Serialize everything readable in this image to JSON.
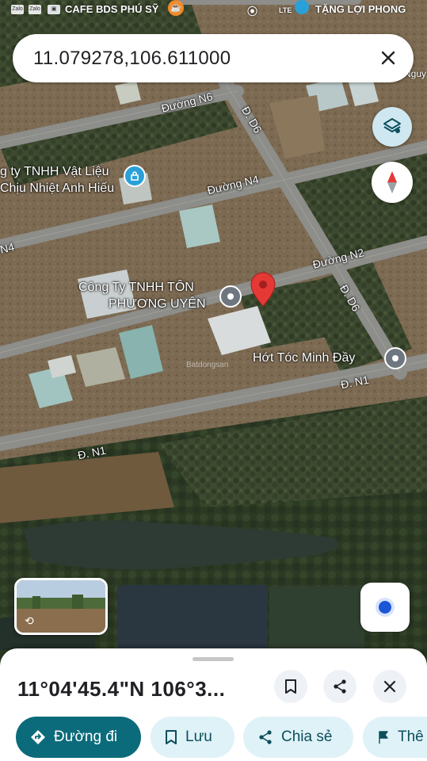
{
  "status_bar": {
    "apps": [
      "Zalo",
      "Zalo"
    ],
    "left_place": "CAFE BDS PHÚ SỸ",
    "network": "LTE",
    "right_place": "TẶNG LỢI PHONG",
    "small_text": "Nguy"
  },
  "search": {
    "value": "11.079278,106.611000"
  },
  "map": {
    "roads": {
      "n6": "Đường N6",
      "n4": "Đường N4",
      "n4_left": "N4",
      "n2": "Đường N2",
      "d6_top": "Đ. D6",
      "d6_mid": "Đ. D6",
      "n1_left": "Đ. N1",
      "n1_right": "Đ. N1"
    },
    "places": {
      "vat_lieu_line1": "g ty TNHH Vật Liệu",
      "vat_lieu_line2": "Chịu Nhiệt Anh Hiếu",
      "ton_line1": "Công Ty TNHH TÔN",
      "ton_line2": "PHƯƠNG UYÊN",
      "hot_toc": "Hớt Tóc Minh Đầy"
    },
    "watermark": "Batdongsan",
    "colors": {
      "pin": "#e53935",
      "place_pin": "#2aa0d8"
    }
  },
  "bottom_sheet": {
    "coordinates": "11°04'45.4\"N 106°3...",
    "buttons": {
      "directions": "Đường đi",
      "save": "Lưu",
      "share": "Chia sẻ",
      "more": "Thê"
    }
  }
}
